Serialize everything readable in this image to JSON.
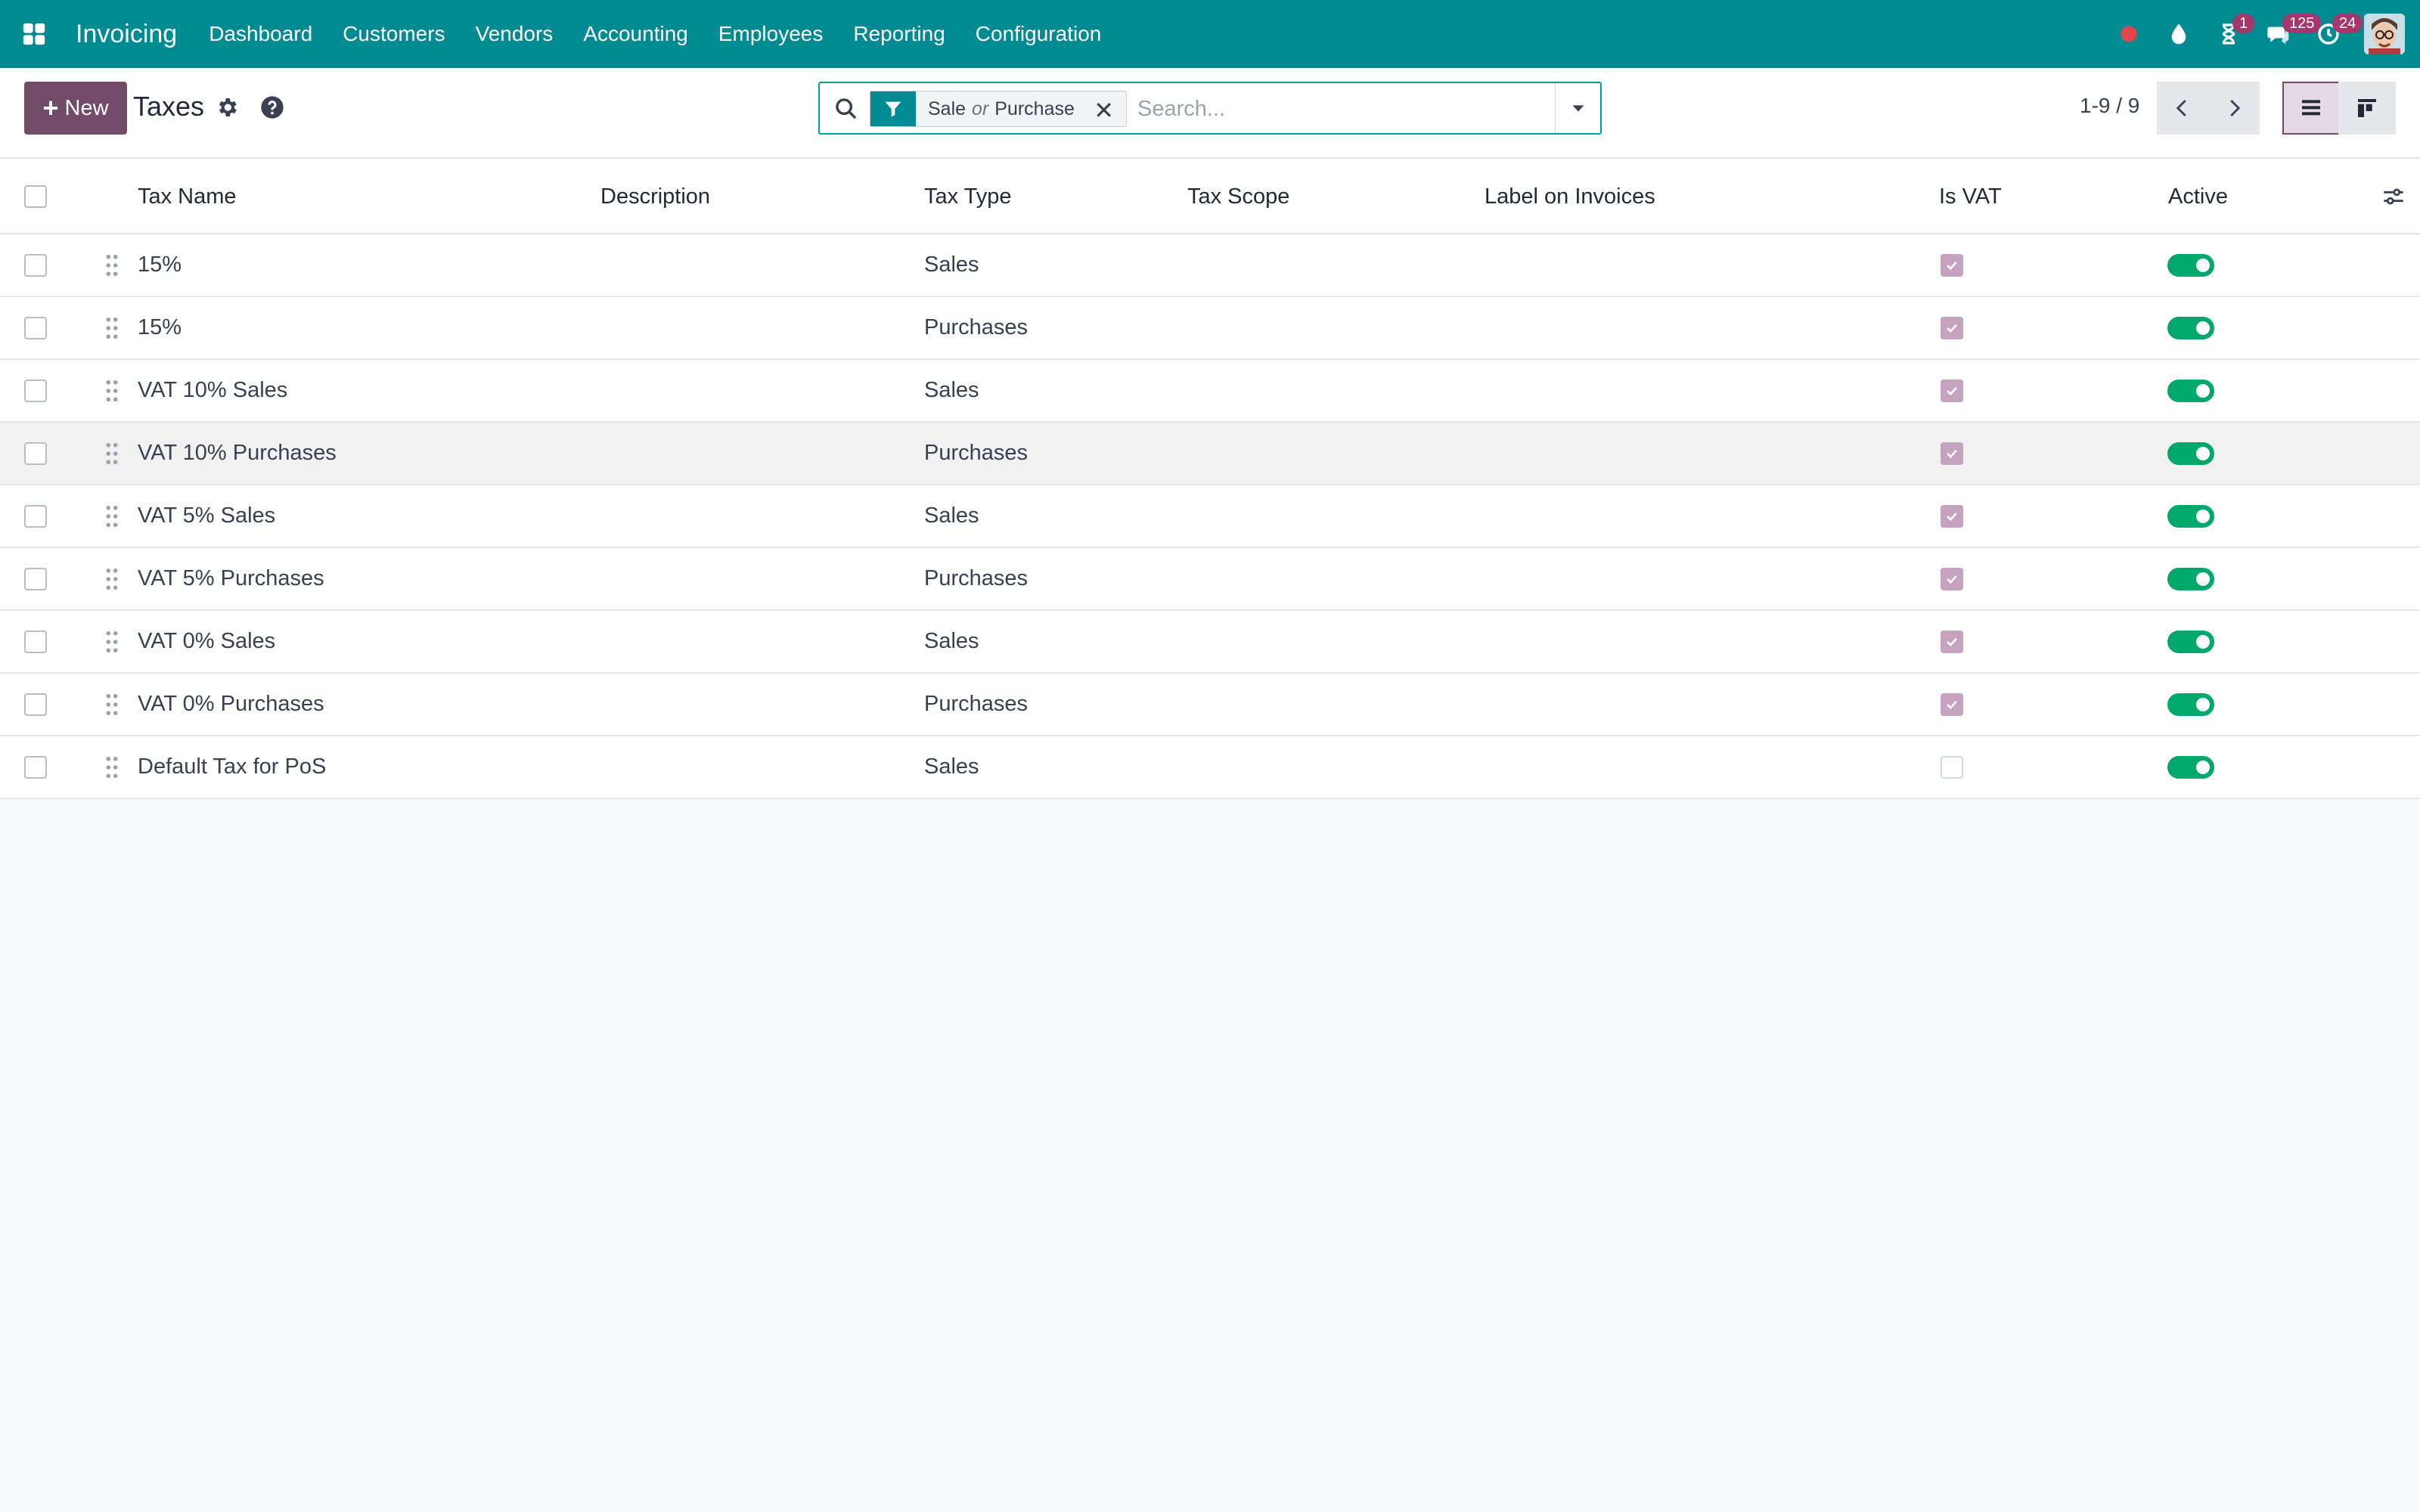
{
  "navbar": {
    "app_name": "Invoicing",
    "menu": [
      "Dashboard",
      "Customers",
      "Vendors",
      "Accounting",
      "Employees",
      "Reporting",
      "Configuration"
    ],
    "activity_badge": "1",
    "messages_badge": "125",
    "clock_badge": "24",
    "color": "#008b93"
  },
  "control": {
    "new_label": "New",
    "page_title": "Taxes",
    "facet_value_1": "Sale",
    "facet_or": "or",
    "facet_value_2": "Purchase",
    "search_placeholder": "Search...",
    "pager": "1-9 / 9"
  },
  "columns": {
    "name": "Tax Name",
    "description": "Description",
    "type": "Tax Type",
    "scope": "Tax Scope",
    "label": "Label on Invoices",
    "is_vat": "Is VAT",
    "active": "Active"
  },
  "rows": [
    {
      "name": "15%",
      "type": "Sales",
      "is_vat": true,
      "active": true
    },
    {
      "name": "15%",
      "type": "Purchases",
      "is_vat": true,
      "active": true
    },
    {
      "name": "VAT 10% Sales",
      "type": "Sales",
      "is_vat": true,
      "active": true
    },
    {
      "name": "VAT 10% Purchases",
      "type": "Purchases",
      "is_vat": true,
      "active": true
    },
    {
      "name": "VAT 5% Sales",
      "type": "Sales",
      "is_vat": true,
      "active": true
    },
    {
      "name": "VAT 5% Purchases",
      "type": "Purchases",
      "is_vat": true,
      "active": true
    },
    {
      "name": "VAT 0% Sales",
      "type": "Sales",
      "is_vat": true,
      "active": true
    },
    {
      "name": "VAT 0% Purchases",
      "type": "Purchases",
      "is_vat": true,
      "active": true
    },
    {
      "name": "Default Tax for PoS",
      "type": "Sales",
      "is_vat": false,
      "active": true
    }
  ],
  "colors": {
    "primary": "#714b67",
    "teal": "#008b93",
    "toggle_on": "#00a86b",
    "vat_check": "#c5a2be"
  }
}
